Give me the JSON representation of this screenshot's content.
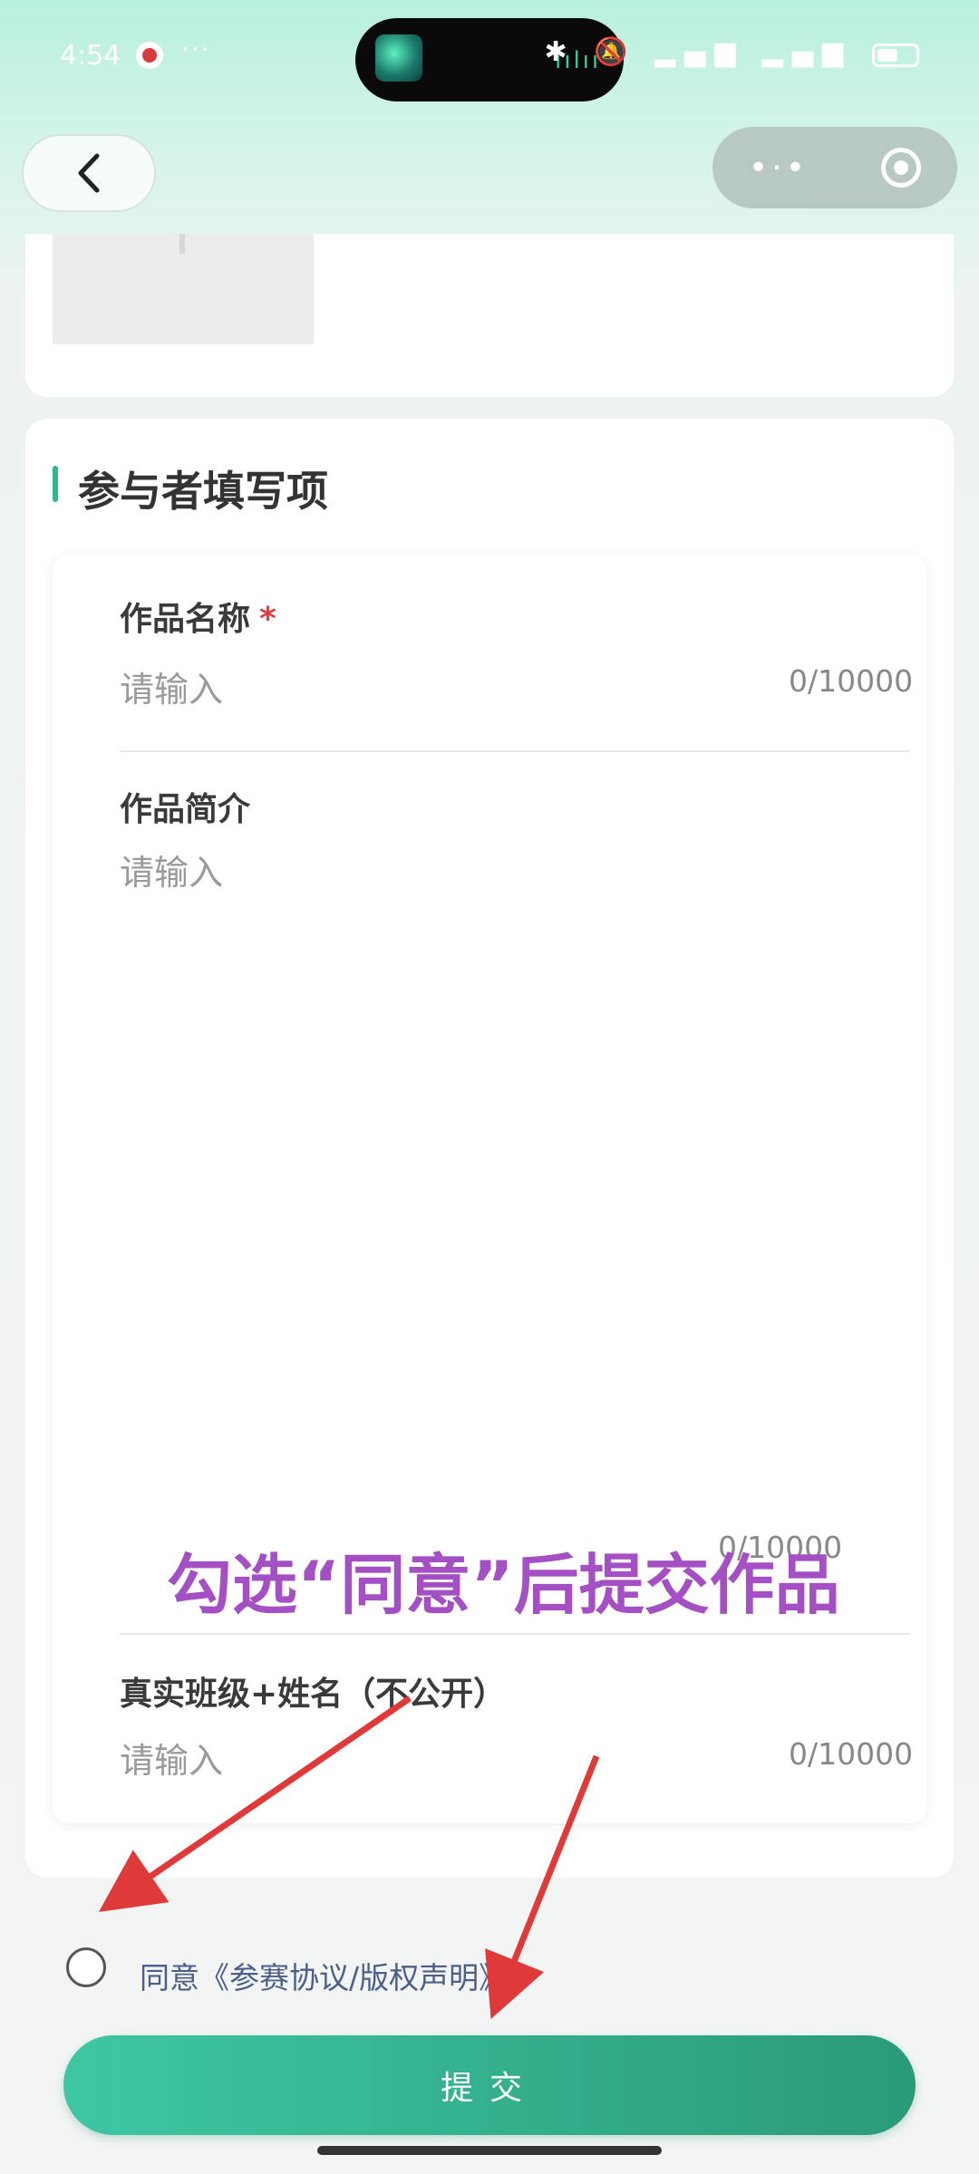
{
  "status_bar": {
    "time": "4:54",
    "more": "···",
    "system_icons": "✱ 🔕 ▂▄▆ ▂▄▆"
  },
  "nav": {
    "capsule_dots": "•·•"
  },
  "section": {
    "title": "参与者填写项"
  },
  "form": {
    "fields": [
      {
        "label": "作品名称",
        "required_mark": "*",
        "placeholder": "请输入",
        "counter": "0/10000"
      },
      {
        "label": "作品简介",
        "placeholder": "请输入",
        "counter": "0/10000"
      },
      {
        "label": "真实班级+姓名（不公开）",
        "placeholder": "请输入",
        "counter": "0/10000"
      }
    ]
  },
  "annotation": {
    "text": "勾选“同意”后提交作品",
    "color": "#a44fc4",
    "arrow_color": "#e0393a"
  },
  "agreement": {
    "text": "同意《参赛协议/版权声明》",
    "checked": false
  },
  "submit": {
    "label": "提交"
  },
  "colors": {
    "accent": "#2fb890",
    "submit_start": "#3ec7a2",
    "submit_end": "#2a9a7a"
  }
}
